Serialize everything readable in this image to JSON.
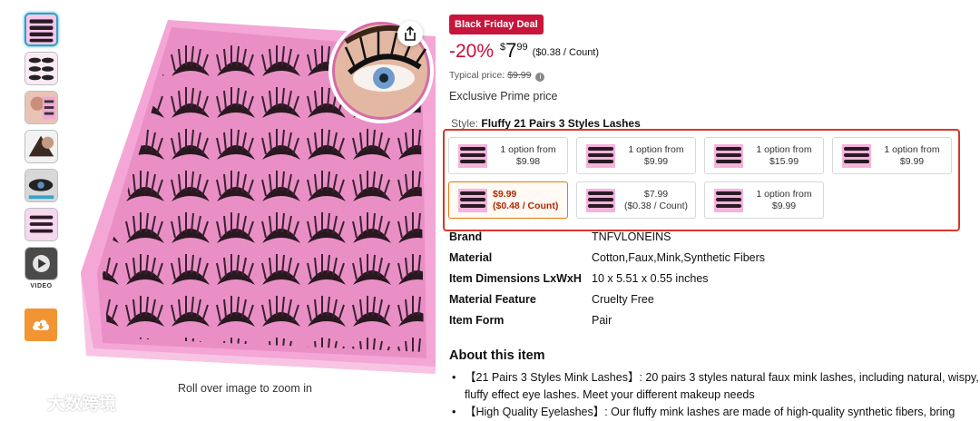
{
  "gallery": {
    "thumbnails": [
      "lash-tray-thumb",
      "lash-pairs-thumb",
      "model-eye-thumb",
      "model-face-thumb",
      "lash-detail-thumb",
      "lash-pack-thumb",
      "video-thumb"
    ],
    "video_label": "VIDEO",
    "zoom_hint": "Roll over image to zoom in",
    "download_icon": "cloud-download-icon",
    "share_icon": "share-icon"
  },
  "deal": {
    "badge": "Black Friday Deal",
    "badge_color": "#c7153b",
    "discount": "-20%",
    "currency": "$",
    "price_whole": "7",
    "price_fraction": "99",
    "unit_price": "($0.38 / Count)",
    "typical_label": "Typical price:",
    "typical_price": "$9.99",
    "prime_text": "Exclusive Prime price"
  },
  "style": {
    "label": "Style:",
    "value": "Fluffy 21 Pairs 3 Styles Lashes",
    "highlight_color": "#d9372b",
    "options": [
      {
        "line1": "1 option from",
        "line2": "$9.98",
        "selected": false
      },
      {
        "line1": "1 option from",
        "line2": "$9.99",
        "selected": false
      },
      {
        "line1": "1 option from",
        "line2": "$15.99",
        "selected": false
      },
      {
        "line1": "1 option from",
        "line2": "$9.99",
        "selected": false
      },
      {
        "line1": "$9.99",
        "line2": "($0.48 / Count)",
        "selected": true
      },
      {
        "line1": "$7.99",
        "line2": "($0.38 / Count)",
        "selected": false
      },
      {
        "line1": "1 option from",
        "line2": "$9.99",
        "selected": false
      }
    ]
  },
  "details": [
    {
      "label": "Brand",
      "value": "TNFVLONEINS"
    },
    {
      "label": "Material",
      "value": "Cotton,Faux,Mink,Synthetic Fibers"
    },
    {
      "label": "Item Dimensions LxWxH",
      "value": "10 x 5.51 x 0.55 inches"
    },
    {
      "label": "Material Feature",
      "value": "Cruelty Free"
    },
    {
      "label": "Item Form",
      "value": "Pair"
    }
  ],
  "about": {
    "title": "About this item",
    "bullets": [
      "【21 Pairs 3 Styles Mink Lashes】: 20 pairs 3 styles natural faux mink lashes, including natural, wispy,",
      "fluffy effect eye lashes. Meet your different makeup needs",
      "【High Quality Eyelashes】: Our fluffy mink lashes are made of high-quality synthetic fibers, bring"
    ]
  },
  "watermark": {
    "text": "大数跨境"
  }
}
